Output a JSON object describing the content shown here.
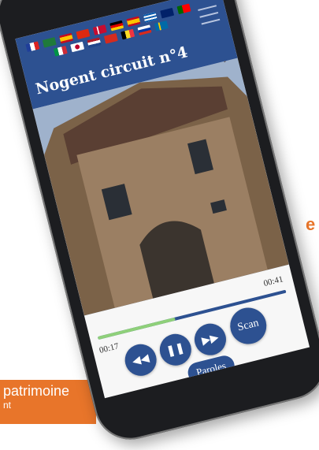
{
  "background": {
    "side_text": "e",
    "banner_line1": "patrimoine",
    "banner_line2": "nt"
  },
  "app": {
    "title": "Nogent circuit n°4",
    "flags": [
      "france",
      "saudi",
      "spain",
      "china",
      "denmark",
      "germany",
      "spain2",
      "greece",
      "uk",
      "portugal",
      "italy",
      "japan",
      "netherlands",
      "switzerland",
      "belgium",
      "russia",
      "sweden"
    ],
    "menu_icon": "hamburger-icon"
  },
  "player": {
    "time_start": "00:17",
    "time_end": "00:41",
    "progress_fraction": 0.41,
    "buttons": {
      "rewind_icon": "rewind-icon",
      "pause_icon": "pause-icon",
      "forward_icon": "fast-forward-icon",
      "scan_label": "Scan",
      "lyrics_label": "Paroles"
    }
  },
  "colors": {
    "accent": "#2d5191",
    "progress": "#8fd07a",
    "orange": "#e8752a"
  }
}
